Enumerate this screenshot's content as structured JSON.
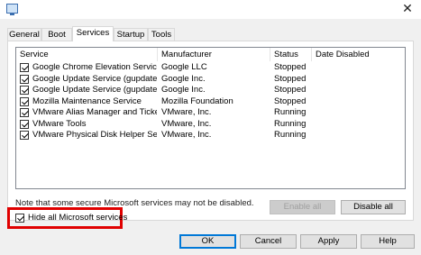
{
  "window": {
    "close_glyph": "✕",
    "app_icon": "window-icon"
  },
  "tabs": [
    "General",
    "Boot",
    "Services",
    "Startup",
    "Tools"
  ],
  "columns": [
    "Service",
    "Manufacturer",
    "Status",
    "Date Disabled"
  ],
  "services": [
    {
      "name": "Google Chrome Elevation Service",
      "manufacturer": "Google LLC",
      "status": "Stopped",
      "date_disabled": "",
      "checked": true
    },
    {
      "name": "Google Update Service (gupdate)",
      "manufacturer": "Google Inc.",
      "status": "Stopped",
      "date_disabled": "",
      "checked": true
    },
    {
      "name": "Google Update Service (gupdatem)",
      "manufacturer": "Google Inc.",
      "status": "Stopped",
      "date_disabled": "",
      "checked": true
    },
    {
      "name": "Mozilla Maintenance Service",
      "manufacturer": "Mozilla Foundation",
      "status": "Stopped",
      "date_disabled": "",
      "checked": true
    },
    {
      "name": "VMware Alias Manager and Ticke...",
      "manufacturer": "VMware, Inc.",
      "status": "Running",
      "date_disabled": "",
      "checked": true
    },
    {
      "name": "VMware Tools",
      "manufacturer": "VMware, Inc.",
      "status": "Running",
      "date_disabled": "",
      "checked": true
    },
    {
      "name": "VMware Physical Disk Helper Ser...",
      "manufacturer": "VMware, Inc.",
      "status": "Running",
      "date_disabled": "",
      "checked": true
    }
  ],
  "note": "Note that some secure Microsoft services may not be disabled.",
  "enable_all": "Enable all",
  "disable_all": "Disable all",
  "hide_ms": {
    "label": "Hide all Microsoft services",
    "checked": true,
    "highlight_color": "#e00000"
  },
  "dialog_buttons": {
    "ok": "OK",
    "cancel": "Cancel",
    "apply": "Apply",
    "help": "Help"
  }
}
